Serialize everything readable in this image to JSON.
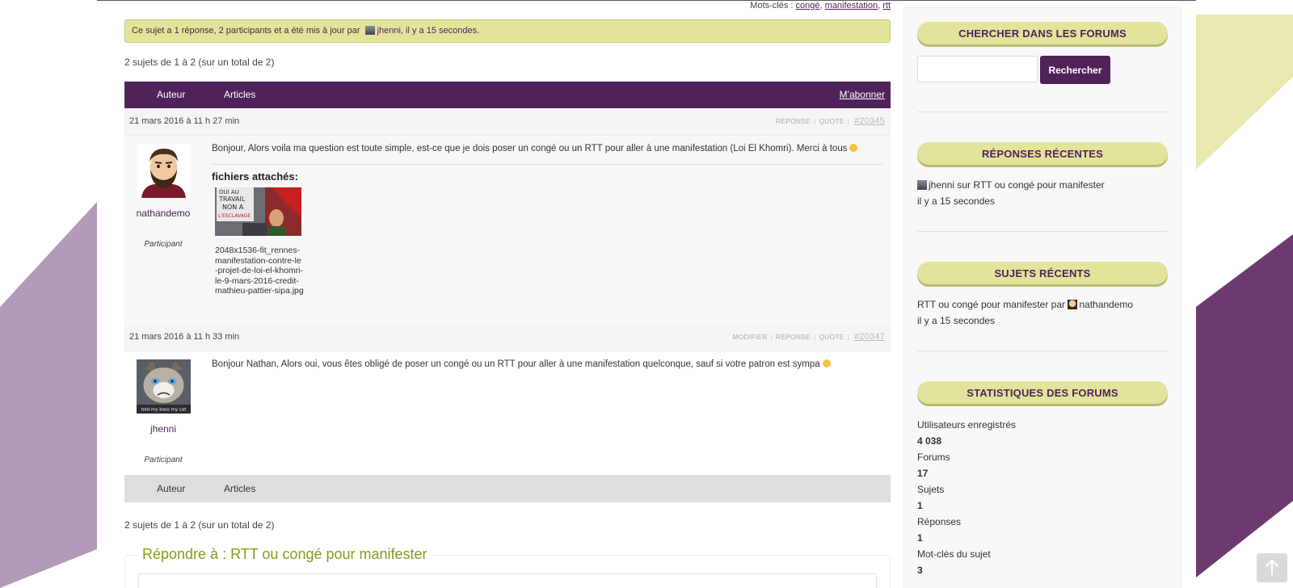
{
  "colors": {
    "brand_purple": "#4f235a",
    "accent_yellow": "#e2e49b",
    "reply_green": "#8a9a1c",
    "bg_lilac": "#b39ab8",
    "bg_purple": "#6d3a6f",
    "bg_yellow": "#e8e8b0"
  },
  "topic": {
    "tags_label": "Mots-clés :",
    "tags": [
      "congé",
      "manifestation",
      "rtt"
    ],
    "notice": {
      "prefix": "Ce sujet a 1 réponse, 2 participants et a été mis à jour par",
      "user": "jhenni, il y a 15 secondes",
      "suffix": "."
    },
    "count_text": "2 sujets de 1 à 2 (sur un total de 2)",
    "header": {
      "author": "Auteur",
      "posts": "Articles",
      "subscribe": "M'abonner"
    }
  },
  "posts": [
    {
      "date": "21 mars 2016 à 11 h 27 min",
      "actions": [
        "RÉPONSE",
        "QUOTE"
      ],
      "permalink": "#20345",
      "author": "nathandemo",
      "role": "Participant",
      "avatar_icon": "bearded-man-avatar",
      "text": "Bonjour, Alors voila ma question est toute simple, est-ce que je dois poser un congé ou un RTT pour aller à une manifestation (Loi El Khomri). Merci à tous",
      "attachments_title": "fichiers attachés:",
      "attachment": {
        "name": "2048x1536-fit_rennes-manifestation-contre-le-projet-de-loi-el-khomri-le-9-mars-2016-credit-mathieu-pattier-sipa.jpg",
        "sign_lines": [
          "OUI AU",
          "TRAVAIL",
          "NON A",
          "L'ESCLAVAGE"
        ]
      }
    },
    {
      "date": "21 mars 2016 à 11 h 33 min",
      "actions": [
        "MODIFIER",
        "RÉPONSE",
        "QUOTE"
      ],
      "permalink": "#20347",
      "author": "jhenni",
      "role": "Participant",
      "avatar_icon": "grumpy-cat-avatar",
      "avatar_caption": "told my boss my cat",
      "text": "Bonjour Nathan, Alors oui, vous êtes obligé de poser un congé ou un RTT pour aller à une manifestation quelconque, sauf si votre patron est sympa"
    }
  ],
  "reply": {
    "title": "Répondre à : RTT ou congé pour manifester"
  },
  "sidebar": {
    "search": {
      "title": "CHERCHER DANS LES FORUMS",
      "button": "Rechercher",
      "placeholder": ""
    },
    "recent_replies": {
      "title": "RÉPONSES RÉCENTES",
      "item": "jhenni sur RTT ou congé pour manifester",
      "time": "il y a 15 secondes"
    },
    "recent_topics": {
      "title": "SUJETS RÉCENTS",
      "item_prefix": "RTT ou congé pour manifester par",
      "item_user": "nathandemo",
      "time": "il y a 15 secondes"
    },
    "stats": {
      "title": "STATISTIQUES DES FORUMS",
      "rows": [
        {
          "label": "Utilisateurs enregistrés",
          "value": "4 038"
        },
        {
          "label": "Forums",
          "value": "17"
        },
        {
          "label": "Sujets",
          "value": "1"
        },
        {
          "label": "Réponses",
          "value": "1"
        },
        {
          "label": "Mot-clés du sujet",
          "value": "3"
        }
      ]
    }
  }
}
